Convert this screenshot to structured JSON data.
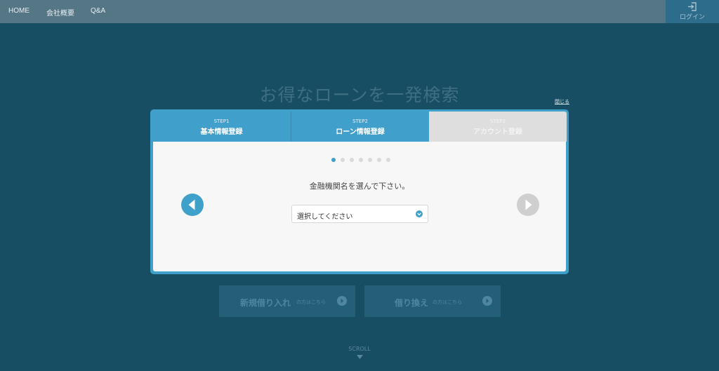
{
  "nav": {
    "items": [
      "HOME",
      "会社概要",
      "Q&A"
    ],
    "login_label": "ログイン"
  },
  "hero": {
    "title": "お得なローンを一発検索"
  },
  "modal": {
    "close_label": "閉じる",
    "steps": [
      {
        "num": "STEP1",
        "name": "基本情報登録",
        "state": "completed"
      },
      {
        "num": "STEP2",
        "name": "ローン情報登録",
        "state": "current"
      },
      {
        "num": "STEP3",
        "name": "アカウント登録",
        "state": "inactive"
      }
    ],
    "pagination": {
      "total": 7,
      "current": 1
    },
    "question": "金融機関名を選んで下さい。",
    "select": {
      "value": "選択してください"
    }
  },
  "cta": {
    "new_main": "新規借り入れ",
    "new_sub": "の方はこちら",
    "refi_main": "借り換え",
    "refi_sub": "の方はこちら"
  },
  "scroll_label": "SCROLL",
  "colors": {
    "accent": "#3fa1c9",
    "background": "#184e63",
    "nav": "#557685"
  }
}
